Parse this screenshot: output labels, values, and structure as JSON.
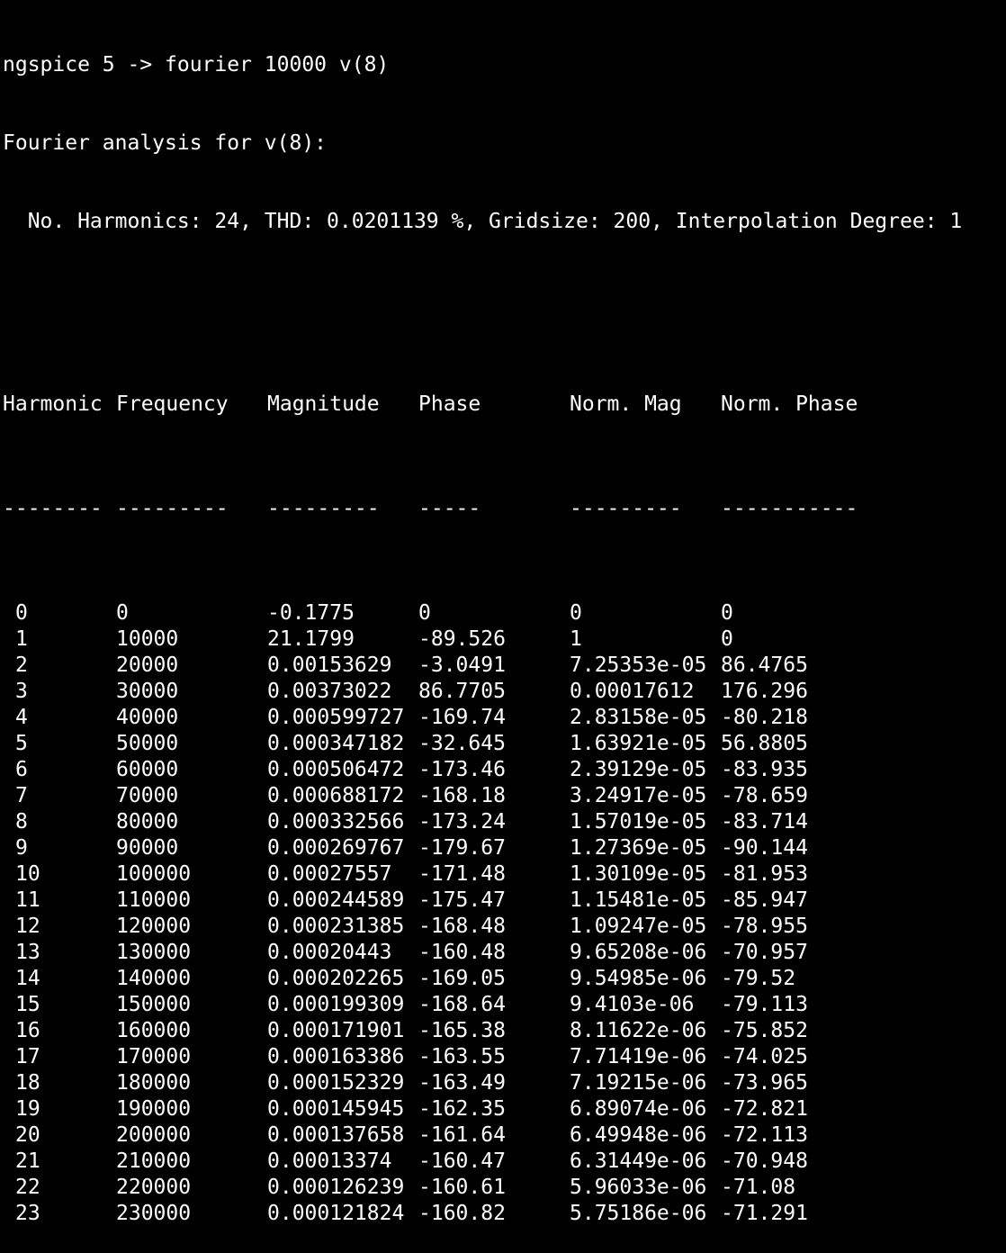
{
  "terminal": {
    "background": "#000000",
    "foreground": "#ffffff",
    "command_line": "ngspice 5 -> fourier 10000 v(8)",
    "analysis_title": "Fourier analysis for v(8):",
    "summary_line": "  No. Harmonics: 24, THD: 0.0201139 %, Gridsize: 200, Interpolation Degree: 1",
    "table": {
      "headers": [
        "Harmonic",
        "Frequency",
        "Magnitude",
        "Phase",
        "Norm. Mag",
        "Norm. Phase"
      ],
      "rules": [
        "--------",
        "---------",
        "---------",
        "-----",
        "---------",
        "-----------"
      ],
      "rows": [
        [
          "0",
          "0",
          "-0.1775",
          "0",
          "0",
          "0"
        ],
        [
          "1",
          "10000",
          "21.1799",
          "-89.526",
          "1",
          "0"
        ],
        [
          "2",
          "20000",
          "0.00153629",
          "-3.0491",
          "7.25353e-05",
          "86.4765"
        ],
        [
          "3",
          "30000",
          "0.00373022",
          "86.7705",
          "0.00017612",
          "176.296"
        ],
        [
          "4",
          "40000",
          "0.000599727",
          "-169.74",
          "2.83158e-05",
          "-80.218"
        ],
        [
          "5",
          "50000",
          "0.000347182",
          "-32.645",
          "1.63921e-05",
          "56.8805"
        ],
        [
          "6",
          "60000",
          "0.000506472",
          "-173.46",
          "2.39129e-05",
          "-83.935"
        ],
        [
          "7",
          "70000",
          "0.000688172",
          "-168.18",
          "3.24917e-05",
          "-78.659"
        ],
        [
          "8",
          "80000",
          "0.000332566",
          "-173.24",
          "1.57019e-05",
          "-83.714"
        ],
        [
          "9",
          "90000",
          "0.000269767",
          "-179.67",
          "1.27369e-05",
          "-90.144"
        ],
        [
          "10",
          "100000",
          "0.00027557",
          "-171.48",
          "1.30109e-05",
          "-81.953"
        ],
        [
          "11",
          "110000",
          "0.000244589",
          "-175.47",
          "1.15481e-05",
          "-85.947"
        ],
        [
          "12",
          "120000",
          "0.000231385",
          "-168.48",
          "1.09247e-05",
          "-78.955"
        ],
        [
          "13",
          "130000",
          "0.00020443",
          "-160.48",
          "9.65208e-06",
          "-70.957"
        ],
        [
          "14",
          "140000",
          "0.000202265",
          "-169.05",
          "9.54985e-06",
          "-79.52"
        ],
        [
          "15",
          "150000",
          "0.000199309",
          "-168.64",
          "9.4103e-06",
          "-79.113"
        ],
        [
          "16",
          "160000",
          "0.000171901",
          "-165.38",
          "8.11622e-06",
          "-75.852"
        ],
        [
          "17",
          "170000",
          "0.000163386",
          "-163.55",
          "7.71419e-06",
          "-74.025"
        ],
        [
          "18",
          "180000",
          "0.000152329",
          "-163.49",
          "7.19215e-06",
          "-73.965"
        ],
        [
          "19",
          "190000",
          "0.000145945",
          "-162.35",
          "6.89074e-06",
          "-72.821"
        ],
        [
          "20",
          "200000",
          "0.000137658",
          "-161.64",
          "6.49948e-06",
          "-72.113"
        ],
        [
          "21",
          "210000",
          "0.00013374",
          "-160.47",
          "6.31449e-06",
          "-70.948"
        ],
        [
          "22",
          "220000",
          "0.000126239",
          "-160.61",
          "5.96033e-06",
          "-71.08"
        ],
        [
          "23",
          "230000",
          "0.000121824",
          "-160.82",
          "5.75186e-06",
          "-71.291"
        ]
      ]
    }
  }
}
